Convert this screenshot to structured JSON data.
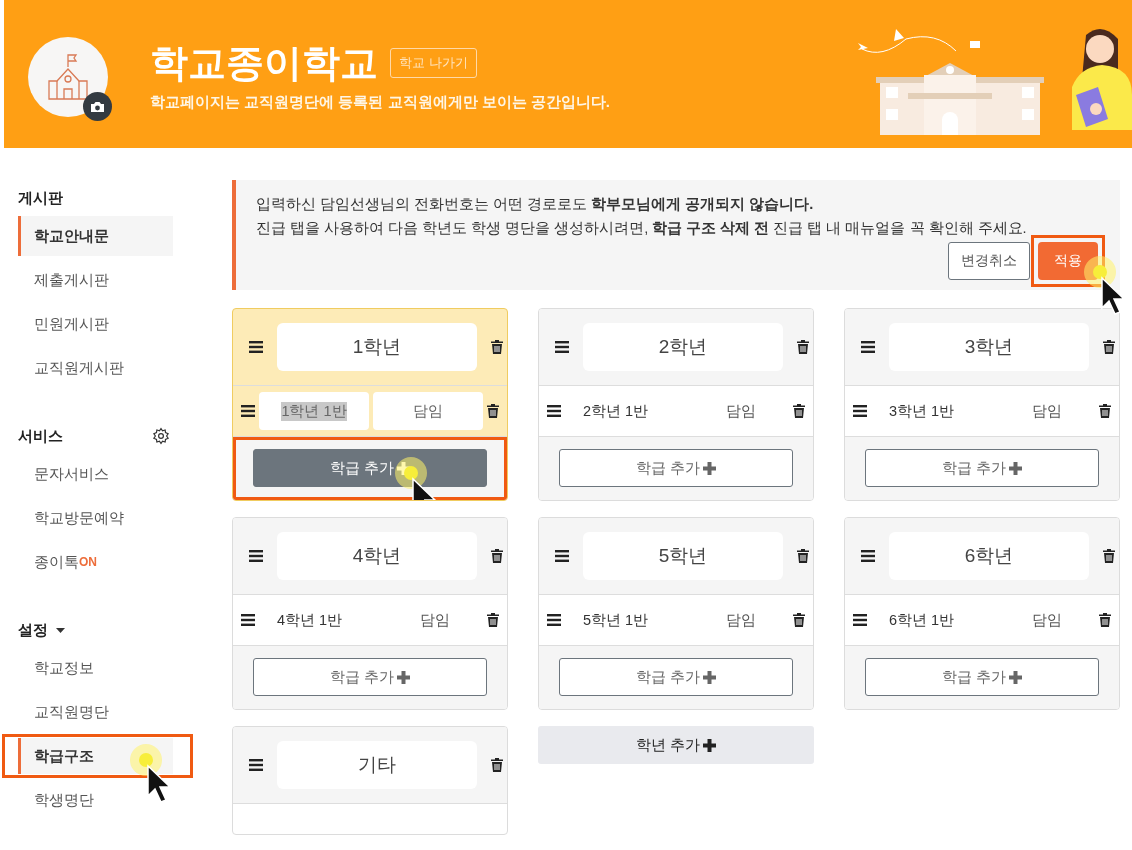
{
  "header": {
    "school_name": "학교종이학교",
    "leave_button": "학교 나가기",
    "notice": "학교페이지는 교직원명단에 등록된 교직원에게만 보이는 공간입니다."
  },
  "sidebar": {
    "sections": [
      {
        "title": "게시판",
        "kind": "plain",
        "items": [
          {
            "label": "학교안내문",
            "selected": true,
            "highlighted": false
          },
          {
            "label": "제출게시판",
            "selected": false,
            "highlighted": false
          },
          {
            "label": "민원게시판",
            "selected": false,
            "highlighted": false
          },
          {
            "label": "교직원게시판",
            "selected": false,
            "highlighted": false
          }
        ]
      },
      {
        "title": "서비스",
        "kind": "settings",
        "items": [
          {
            "label": "문자서비스",
            "selected": false,
            "highlighted": false
          },
          {
            "label": "학교방문예약",
            "selected": false,
            "highlighted": false
          },
          {
            "label": "종이톡",
            "badge": "ON",
            "selected": false,
            "highlighted": false
          }
        ]
      },
      {
        "title": "설정",
        "kind": "dropdown",
        "items": [
          {
            "label": "학교정보",
            "selected": false,
            "highlighted": false
          },
          {
            "label": "교직원명단",
            "selected": false,
            "highlighted": false
          },
          {
            "label": "학급구조",
            "selected": true,
            "highlighted": true
          },
          {
            "label": "학생명단",
            "selected": false,
            "highlighted": false
          }
        ]
      }
    ]
  },
  "alert": {
    "lines": [
      "입력하신 담임선생님의 전화번호는 어떤 경로로도 **학부모님에게 공개되지 않습니다.**",
      "진급 탭을 사용하여 다음 학년도 학생 명단을 생성하시려면, **학급 구조 삭제 전** 진급 탭 내 매뉴얼을 꼭 확인해 주세요."
    ],
    "buttons": [
      {
        "label": "변경취소",
        "kind": "secondary",
        "highlighted": false
      },
      {
        "label": "적용",
        "kind": "primary",
        "highlighted": true
      }
    ]
  },
  "grades": [
    {
      "name": "1학년",
      "active": true,
      "classes": [
        {
          "kind": "editing",
          "name": "1학년 1반",
          "teacher": "담임",
          "name_selected": true
        }
      ],
      "add_button": {
        "label": "학급 추가",
        "hovered": true,
        "highlighted": true
      }
    },
    {
      "name": "2학년",
      "active": false,
      "classes": [
        {
          "kind": "plain",
          "name": "2학년 1반",
          "teacher": "담임",
          "name_selected": false
        }
      ],
      "add_button": {
        "label": "학급 추가",
        "hovered": false,
        "highlighted": false
      }
    },
    {
      "name": "3학년",
      "active": false,
      "classes": [
        {
          "kind": "plain",
          "name": "3학년 1반",
          "teacher": "담임",
          "name_selected": false
        }
      ],
      "add_button": {
        "label": "학급 추가",
        "hovered": false,
        "highlighted": false
      }
    },
    {
      "name": "4학년",
      "active": false,
      "classes": [
        {
          "kind": "plain",
          "name": "4학년 1반",
          "teacher": "담임",
          "name_selected": false
        }
      ],
      "add_button": {
        "label": "학급 추가",
        "hovered": false,
        "highlighted": false
      }
    },
    {
      "name": "5학년",
      "active": false,
      "classes": [
        {
          "kind": "plain",
          "name": "5학년 1반",
          "teacher": "담임",
          "name_selected": false
        }
      ],
      "add_button": {
        "label": "학급 추가",
        "hovered": false,
        "highlighted": false
      }
    },
    {
      "name": "6학년",
      "active": false,
      "classes": [
        {
          "kind": "plain",
          "name": "6학년 1반",
          "teacher": "담임",
          "name_selected": false
        }
      ],
      "add_button": {
        "label": "학급 추가",
        "hovered": false,
        "highlighted": false
      }
    },
    {
      "name": "기타",
      "active": false,
      "classes": [
        {
          "kind": "clipped"
        }
      ]
    }
  ],
  "add_grade_button": "학년 추가"
}
